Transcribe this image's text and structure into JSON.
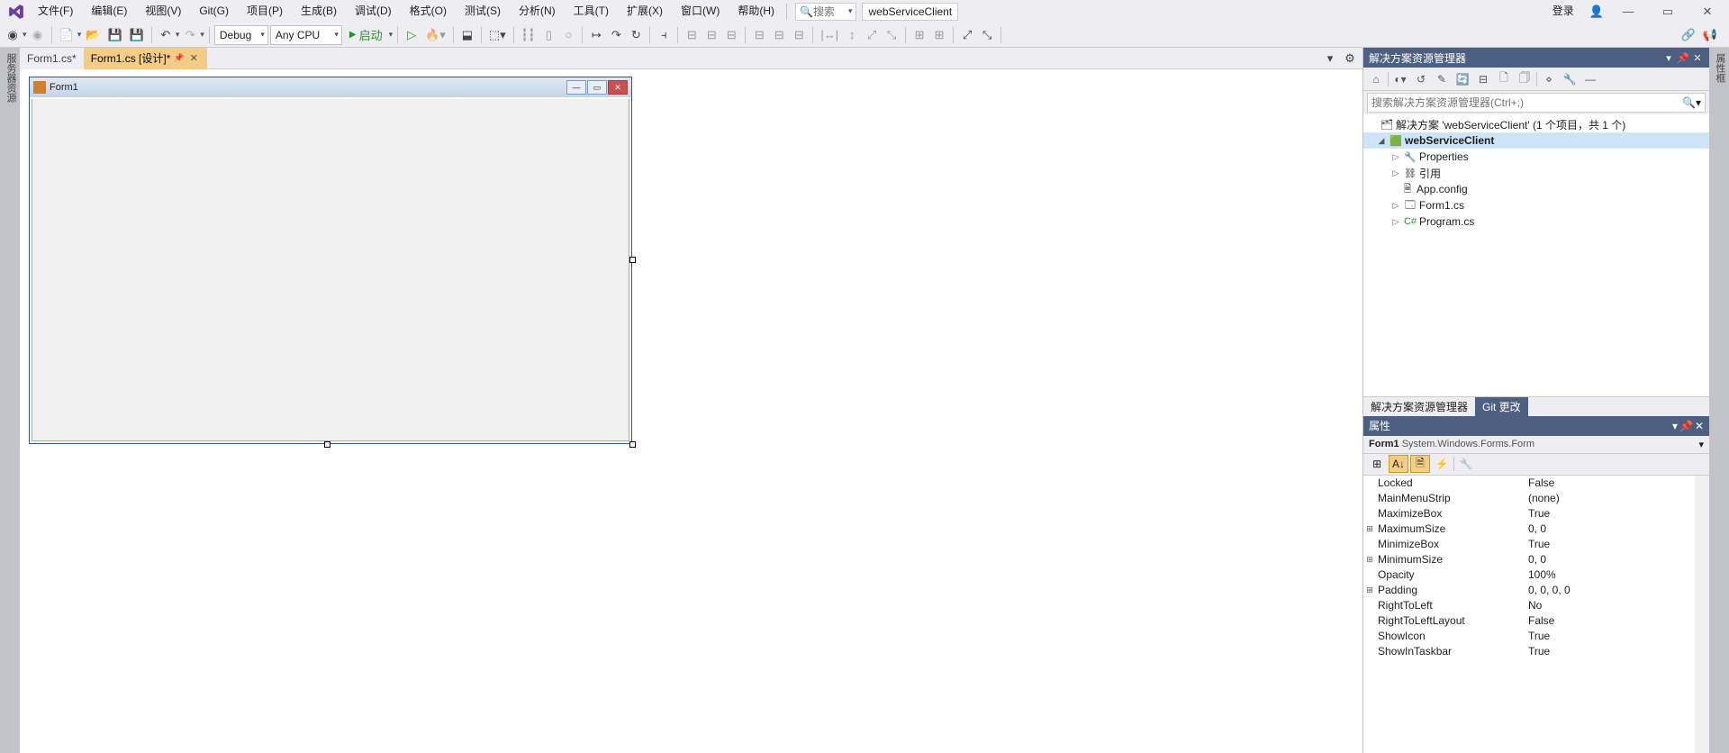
{
  "menu": {
    "items": [
      "文件(F)",
      "编辑(E)",
      "视图(V)",
      "Git(G)",
      "项目(P)",
      "生成(B)",
      "调试(D)",
      "格式(O)",
      "测试(S)",
      "分析(N)",
      "工具(T)",
      "扩展(X)",
      "窗口(W)",
      "帮助(H)"
    ],
    "search_label": "搜索",
    "solution_name": "webServiceClient",
    "login": "登录"
  },
  "toolbar": {
    "config": "Debug",
    "platform": "Any CPU",
    "start": "启动"
  },
  "leftTab": "服务器资源",
  "rightTab": "属性框",
  "docTabs": {
    "tab1": "Form1.cs*",
    "tab2": "Form1.cs [设计]*"
  },
  "designer": {
    "form_title": "Form1"
  },
  "explorer": {
    "title": "解决方案资源管理器",
    "search_placeholder": "搜索解决方案资源管理器(Ctrl+;)",
    "root": "解决方案 'webServiceClient' (1 个项目，共 1 个)",
    "project": "webServiceClient",
    "properties": "Properties",
    "references": "引用",
    "appconfig": "App.config",
    "form1cs": "Form1.cs",
    "programcs": "Program.cs",
    "bottomTabs": {
      "t1": "解决方案资源管理器",
      "t2": "Git 更改"
    }
  },
  "props": {
    "title": "属性",
    "object": "Form1",
    "type": "System.Windows.Forms.Form",
    "rows": [
      {
        "exp": "",
        "name": "Locked",
        "val": "False"
      },
      {
        "exp": "",
        "name": "MainMenuStrip",
        "val": "(none)"
      },
      {
        "exp": "",
        "name": "MaximizeBox",
        "val": "True"
      },
      {
        "exp": "⊞",
        "name": "MaximumSize",
        "val": "0, 0"
      },
      {
        "exp": "",
        "name": "MinimizeBox",
        "val": "True"
      },
      {
        "exp": "⊞",
        "name": "MinimumSize",
        "val": "0, 0"
      },
      {
        "exp": "",
        "name": "Opacity",
        "val": "100%"
      },
      {
        "exp": "⊞",
        "name": "Padding",
        "val": "0, 0, 0, 0"
      },
      {
        "exp": "",
        "name": "RightToLeft",
        "val": "No"
      },
      {
        "exp": "",
        "name": "RightToLeftLayout",
        "val": "False"
      },
      {
        "exp": "",
        "name": "ShowIcon",
        "val": "True"
      },
      {
        "exp": "",
        "name": "ShowInTaskbar",
        "val": "True"
      }
    ]
  }
}
